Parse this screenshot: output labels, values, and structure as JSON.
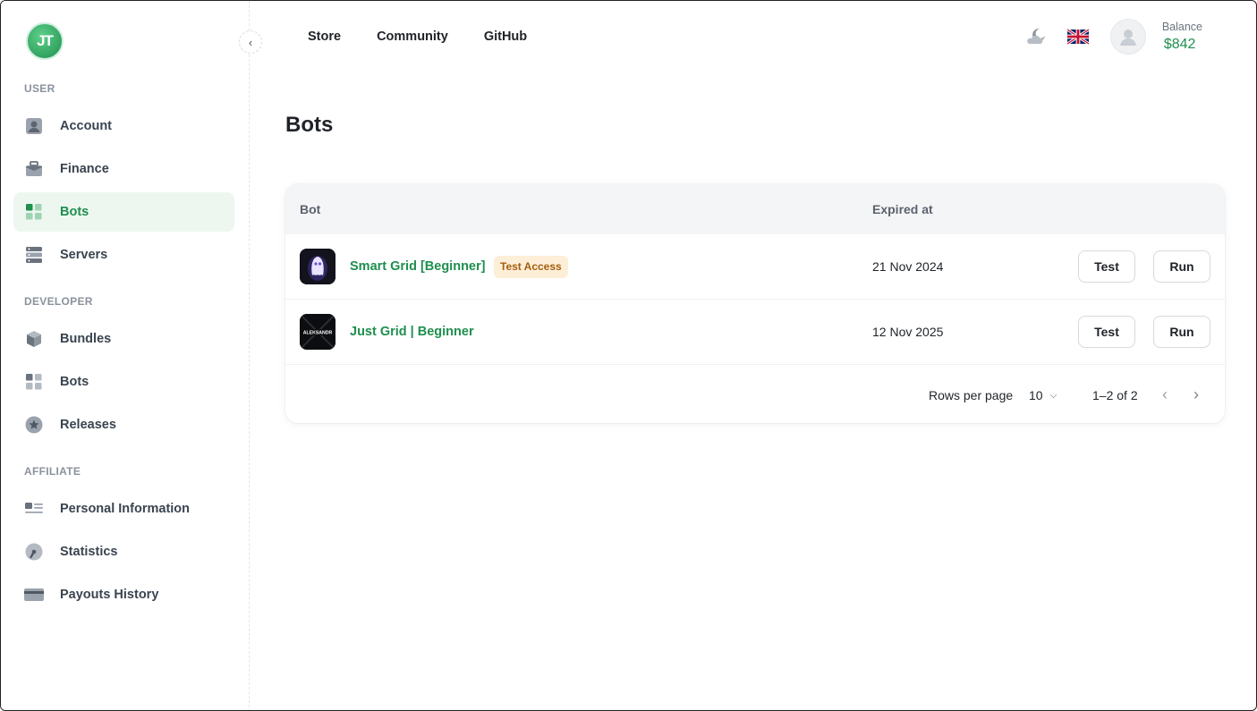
{
  "sidebar": {
    "logo_text": "JT",
    "sections": [
      {
        "label": "USER",
        "items": [
          {
            "label": "Account",
            "icon": "account-icon"
          },
          {
            "label": "Finance",
            "icon": "briefcase-icon"
          },
          {
            "label": "Bots",
            "icon": "grid-icon",
            "active": true
          },
          {
            "label": "Servers",
            "icon": "server-icon"
          }
        ]
      },
      {
        "label": "DEVELOPER",
        "items": [
          {
            "label": "Bundles",
            "icon": "cube-icon"
          },
          {
            "label": "Bots",
            "icon": "grid-icon"
          },
          {
            "label": "Releases",
            "icon": "star-badge-icon"
          }
        ]
      },
      {
        "label": "AFFILIATE",
        "items": [
          {
            "label": "Personal Information",
            "icon": "id-card-icon"
          },
          {
            "label": "Statistics",
            "icon": "gauge-icon"
          },
          {
            "label": "Payouts History",
            "icon": "credit-card-icon"
          }
        ]
      }
    ]
  },
  "header": {
    "nav": [
      "Store",
      "Community",
      "GitHub"
    ],
    "balance_label": "Balance",
    "balance_value": "$842"
  },
  "main": {
    "title": "Bots",
    "table": {
      "columns": [
        "Bot",
        "Expired at"
      ],
      "rows": [
        {
          "name": "Smart Grid [Beginner]",
          "badge": "Test Access",
          "expired": "21 Nov 2024",
          "test_label": "Test",
          "run_label": "Run"
        },
        {
          "name": "Just Grid | Beginner",
          "badge": "",
          "thumb_text": "ALEKSANDR",
          "expired": "12 Nov 2025",
          "test_label": "Test",
          "run_label": "Run"
        }
      ]
    },
    "pagination": {
      "rows_per_page_label": "Rows per page",
      "rows_per_page": "10",
      "range": "1–2 of 2"
    }
  },
  "colors": {
    "accent": "#1e8f4e",
    "active_bg": "#eef6f0",
    "badge_bg": "#fdeed8",
    "badge_text": "#a45d0c"
  }
}
